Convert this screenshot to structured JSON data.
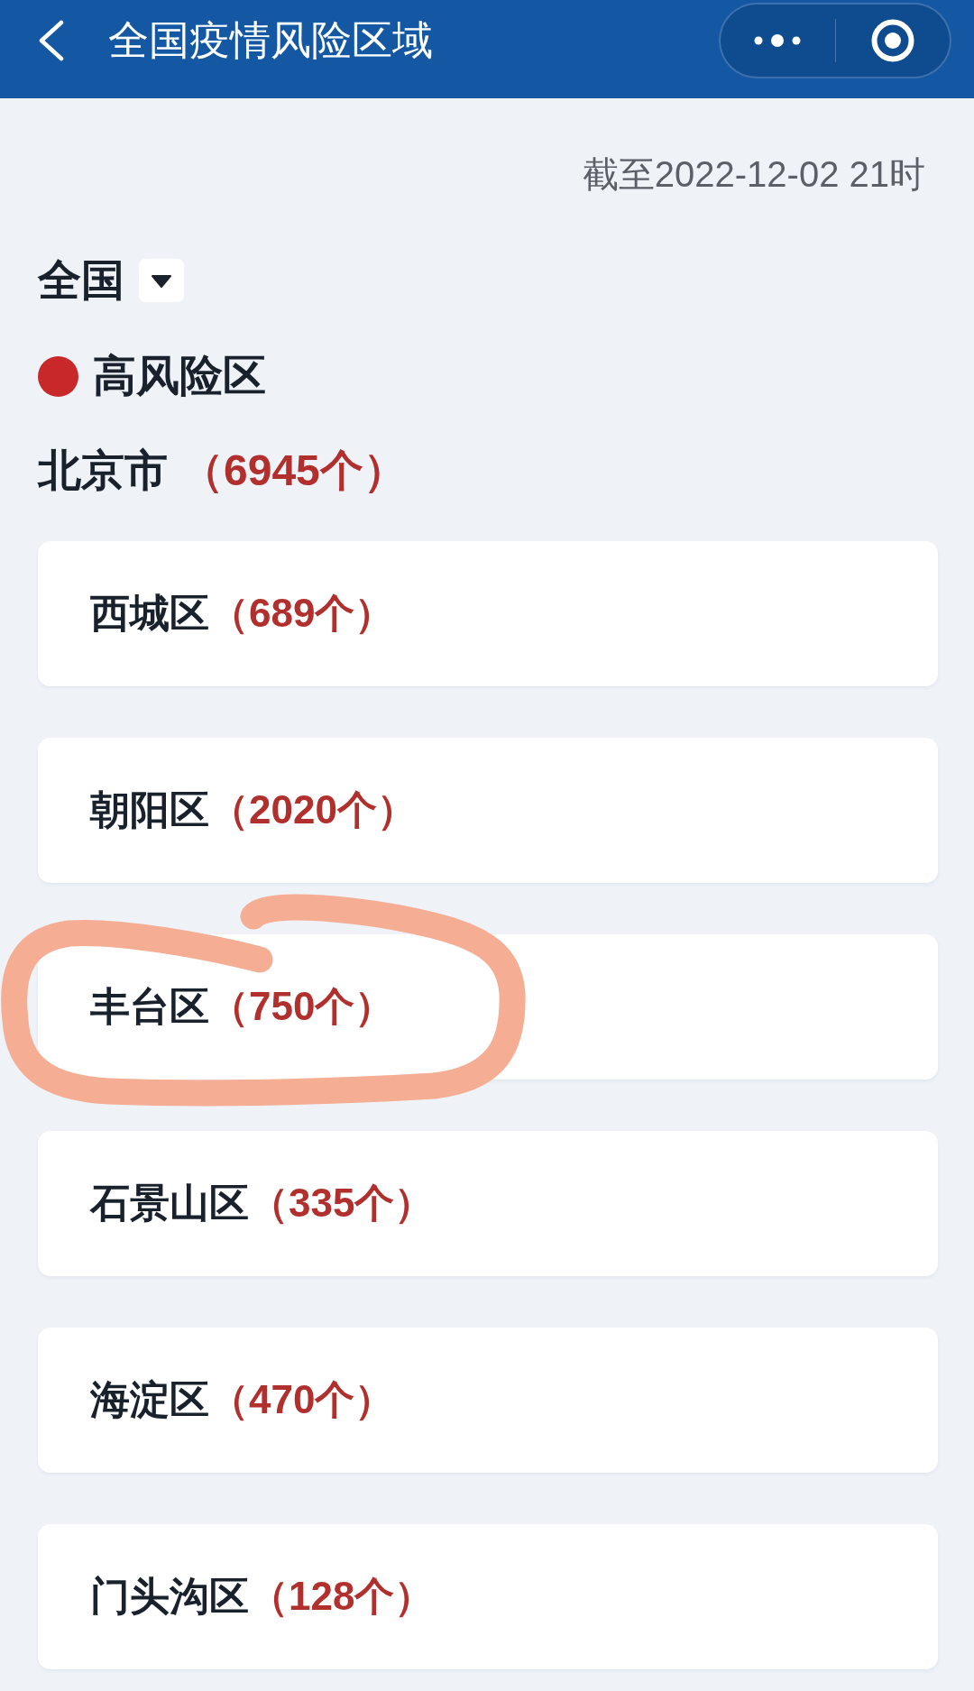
{
  "header": {
    "title": "全国疫情风险区域"
  },
  "updated": "截至2022-12-02 21时",
  "region_selector": {
    "label": "全国"
  },
  "risk_level": {
    "label": "高风险区"
  },
  "city": {
    "name": "北京市",
    "count": "（6945个）"
  },
  "districts": [
    {
      "name": "西城区",
      "count": "（689个）",
      "circled": false
    },
    {
      "name": "朝阳区",
      "count": "（2020个）",
      "circled": false
    },
    {
      "name": "丰台区",
      "count": "（750个）",
      "circled": true
    },
    {
      "name": "石景山区",
      "count": "（335个）",
      "circled": false
    },
    {
      "name": "海淀区",
      "count": "（470个）",
      "circled": false
    },
    {
      "name": "门头沟区",
      "count": "（128个）",
      "circled": false
    }
  ]
}
